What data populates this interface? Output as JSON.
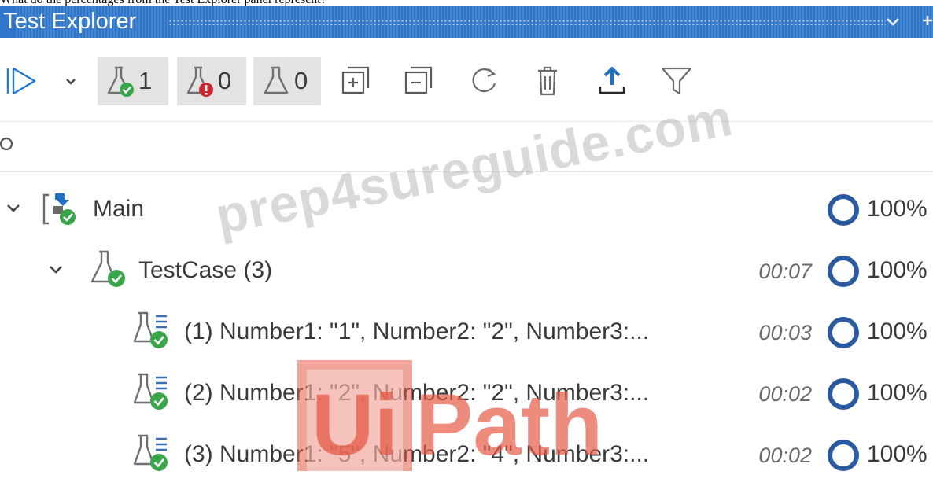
{
  "question_text": "What do the percentages from the Test Explorer panel represent?",
  "panel": {
    "title": "Test Explorer",
    "toolbar": {
      "passed_count": "1",
      "failed_count": "0",
      "not_run_count": "0"
    }
  },
  "tree": [
    {
      "label": "Main",
      "time": "",
      "coverage": "100%",
      "level": 0,
      "icon": "workflow-passed-icon"
    },
    {
      "label": "TestCase (3)",
      "time": "00:07",
      "coverage": "100%",
      "level": 1,
      "icon": "test-flask-passed-icon"
    },
    {
      "label": "(1) Number1: \"1\", Number2: \"2\", Number3:...",
      "time": "00:03",
      "coverage": "100%",
      "level": 2,
      "icon": "data-test-passed-icon"
    },
    {
      "label": "(2) Number1: \"2\", Number2: \"2\", Number3:...",
      "time": "00:02",
      "coverage": "100%",
      "level": 2,
      "icon": "data-test-passed-icon"
    },
    {
      "label": "(3) Number1: \"5\", Number2: \"4\", Number3:...",
      "time": "00:02",
      "coverage": "100%",
      "level": 2,
      "icon": "data-test-passed-icon"
    }
  ],
  "watermarks": {
    "site": "prep4sureguide.com",
    "logo": "UiPath"
  },
  "colors": {
    "titlebar": "#2f75c9",
    "passed_green": "#3aa64a",
    "failed_red": "#c8272d",
    "coverage_ring": "#2c5aa0"
  }
}
